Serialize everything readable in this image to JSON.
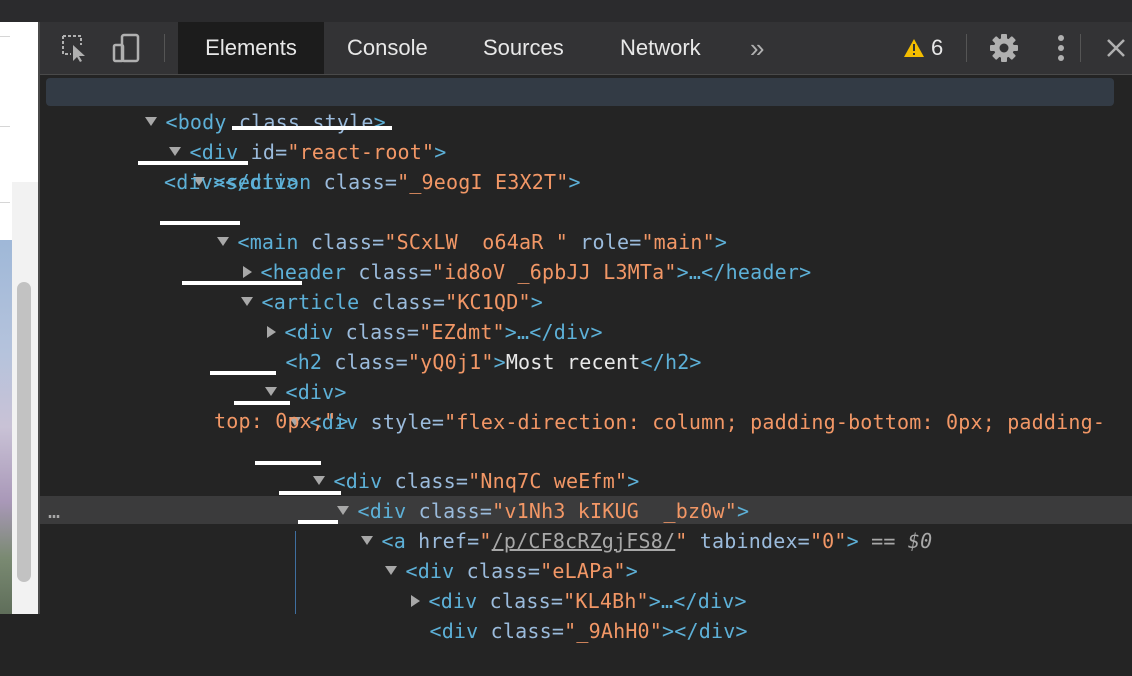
{
  "toolbar": {
    "tabs": [
      "Elements",
      "Console",
      "Sources",
      "Network"
    ],
    "more_tabs": "»",
    "warning_count": "6"
  },
  "tree": {
    "body_tag": "<body",
    "body_attrs": " class style",
    "body_close": ">",
    "react_root_open": "<div",
    "id_attr": " id=",
    "react_root_value": "\"react-root\"",
    "section_open": "<section",
    "section_class_attr": " class=",
    "section_class_value": "\"_9eogI E3X2T\"",
    "empty_div": "<div></div>",
    "main_open": "<main",
    "main_class_attr": " class=",
    "main_class_value": "\"SCxLW  o64aR \"",
    "main_role_attr": " role=",
    "main_role_value": "\"main\"",
    "header_open": "<header",
    "header_class_attr": " class=",
    "header_class_value": "\"id8oV _6pbJJ L3MTa\"",
    "header_close": ">…</header>",
    "article_open": "<article",
    "article_class_attr": " class=",
    "article_class_value": "\"KC1QD\"",
    "ezdmt_open": "<div",
    "ezdmt_class_attr": " class=",
    "ezdmt_class_value": "\"EZdmt\"",
    "ezdmt_close": ">…</div>",
    "h2_open": "<h2",
    "h2_class_attr": " class=",
    "h2_class_value": "\"yQ0j1\"",
    "h2_text": "Most recent",
    "h2_close": "</h2>",
    "plain_div": "<div>",
    "style_div_open": "<div",
    "style_attr": " style=",
    "style_value_1": "\"flex-direction: column; padding-bottom: 0px; padding-",
    "style_value_2": "top: 0px;\"",
    "nnq_open": "<div",
    "nnq_class_attr": " class=",
    "nnq_class_value": "\"Nnq7C weEfm\"",
    "v1n_open": "<div",
    "v1n_class_attr": " class=",
    "v1n_class_value": "\"v1Nh3 kIKUG  _bz0w\"",
    "a_open": "<a",
    "a_href_attr": " href=",
    "a_href_quote_open": "\"",
    "a_href_value": "/p/CF8cRZgjFS8/",
    "a_href_quote_close": "\"",
    "a_tabindex_attr": " tabindex=",
    "a_tabindex_value": "\"0\"",
    "a_eq": " == ",
    "a_sel": "$0",
    "row_dots": "…",
    "elapa_open": "<div",
    "elapa_class_attr": " class=",
    "elapa_class_value": "\"eLAPa\"",
    "kl4_open": "<div",
    "kl4_class_attr": " class=",
    "kl4_class_value": "\"KL4Bh\"",
    "kl4_close": ">…</div>",
    "ahh_open": "<div",
    "ahh_class_attr": " class=",
    "ahh_class_value": "\"_9AhH0\"",
    "ahh_close": "></div>"
  },
  "colors": {
    "tag": "#5db0d7",
    "attr_name": "#9bbbdc",
    "attr_value": "#f29766",
    "text": "#e8e8e8",
    "background": "#242424",
    "warning": "#f4bd00"
  },
  "icons": [
    "select-element-icon",
    "device-toggle-icon",
    "warning-icon",
    "gear-icon",
    "kebab-menu-icon",
    "close-icon"
  ]
}
